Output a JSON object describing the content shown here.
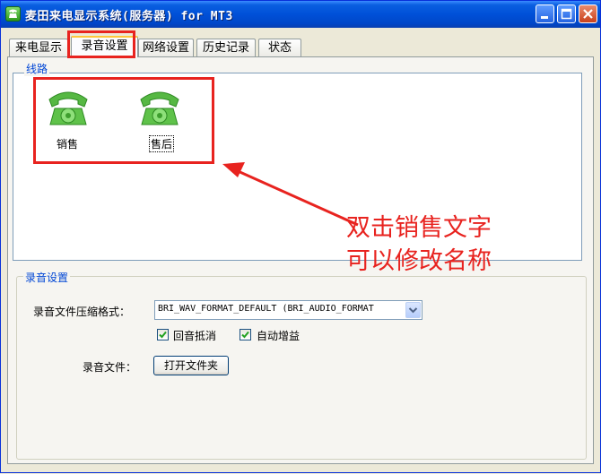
{
  "window": {
    "title": "麦田来电显示系统(服务器) for MT3",
    "controls": {
      "minimize": "minimize-icon",
      "maximize": "maximize-icon",
      "close": "close-icon"
    }
  },
  "tabs": [
    {
      "label": "来电显示"
    },
    {
      "label": "录音设置",
      "active": true
    },
    {
      "label": "网络设置"
    },
    {
      "label": "历史记录"
    },
    {
      "label": "状态"
    }
  ],
  "lines": {
    "group_title": "线路",
    "items": [
      {
        "label": "销售",
        "icon": "telephone-icon"
      },
      {
        "label": "售后",
        "icon": "telephone-icon"
      }
    ]
  },
  "annotation": {
    "line1": "双击销售文字",
    "line2": "可以修改名称",
    "color": "#e8231f"
  },
  "recording": {
    "group_title": "录音设置",
    "format_label": "录音文件压缩格式：",
    "format_value": "BRI_WAV_FORMAT_DEFAULT (BRI_AUDIO_FORMAT",
    "echo_cancel": {
      "label": "回音抵消",
      "checked": true
    },
    "auto_gain": {
      "label": "自动增益",
      "checked": true
    },
    "file_label": "录音文件：",
    "open_folder_button": "打开文件夹"
  },
  "colors": {
    "titlebar": "#0050d8",
    "group_title": "#0046d5",
    "highlight": "#e8231f",
    "phone": "#5fc24a"
  }
}
